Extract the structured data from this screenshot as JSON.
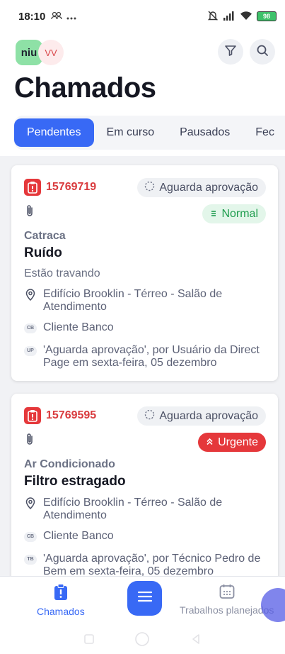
{
  "status_bar": {
    "time": "18:10",
    "left_icons": [
      "people-icon",
      "more-icon"
    ],
    "right_icons": [
      "mute-icon",
      "signal-icon",
      "wifi-icon",
      "battery-icon"
    ],
    "battery_level": "98"
  },
  "header": {
    "logo_text": "niu",
    "avatar_initials": "VV",
    "title": "Chamados",
    "filter_icon": "filter-icon",
    "search_icon": "search-icon"
  },
  "tabs": [
    {
      "label": "Pendentes",
      "active": true
    },
    {
      "label": "Em curso",
      "active": false
    },
    {
      "label": "Pausados",
      "active": false
    },
    {
      "label": "Fec",
      "active": false
    }
  ],
  "tickets": [
    {
      "number": "15769719",
      "status": "Aguarda aprovação",
      "priority": "Normal",
      "priority_color": "#1f9d4e",
      "category": "Catraca",
      "title": "Ruído",
      "description": "Estão travando",
      "location": "Edifício Brooklin - Térreo - Salão de Atendimento",
      "client_badge": "CB",
      "client": "Cliente Banco",
      "user_badge": "UP",
      "history": "'Aguarda aprovação', por Usuário da Direct Page em sexta-feira, 05 dezembro"
    },
    {
      "number": "15769595",
      "status": "Aguarda aprovação",
      "priority": "Urgente",
      "priority_color": "#e5383b",
      "category": "Ar Condicionado",
      "title": "Filtro estragado",
      "description": "",
      "location": "Edifício Brooklin - Térreo - Salão de Atendimento",
      "client_badge": "CB",
      "client": "Cliente Banco",
      "user_badge": "TB",
      "history": "'Aguarda aprovação', por Técnico Pedro de Bem em sexta-feira, 05 dezembro"
    }
  ],
  "bottom_nav": {
    "left_label": "Chamados",
    "right_label": "Trabalhos planejados",
    "fab_icon": "menu-icon"
  },
  "colors": {
    "accent": "#3869f5",
    "danger": "#e5383b",
    "success": "#1f9d4e"
  }
}
